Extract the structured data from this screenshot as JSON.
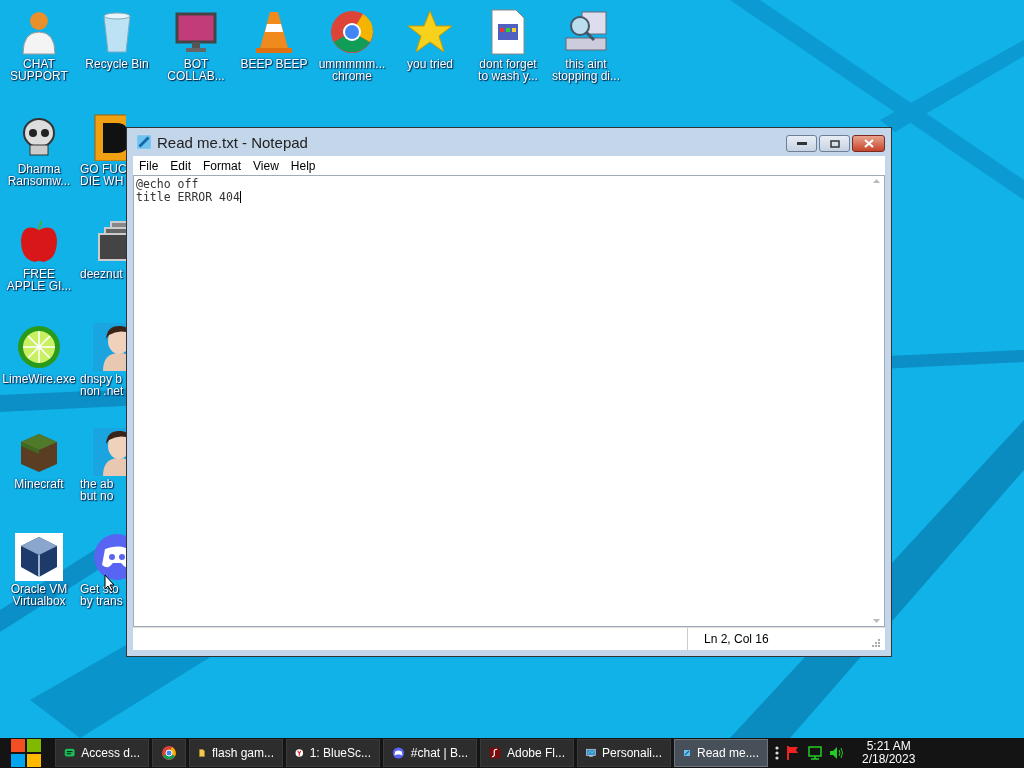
{
  "desktop": {
    "icons": [
      {
        "label": "CHAT\nSUPPORT"
      },
      {
        "label": "Recycle Bin"
      },
      {
        "label": "BOT\nCOLLAB..."
      },
      {
        "label": "BEEP BEEP"
      },
      {
        "label": "ummmmm...\nchrome"
      },
      {
        "label": "you tried"
      },
      {
        "label": "dont forget\nto wash y..."
      },
      {
        "label": "this aint\nstopping di..."
      },
      {
        "label": "Dharma\nRansomw..."
      },
      {
        "label": "GO FUC\nDIE WH"
      },
      {
        "label": "FREE\nAPPLE GI..."
      },
      {
        "label": "deeznut"
      },
      {
        "label": "LimeWire.exe"
      },
      {
        "label": "dnspy b\nnon .net"
      },
      {
        "label": "Minecraft"
      },
      {
        "label": "the ab\nbut no"
      },
      {
        "label": "Oracle VM\nVirtualbox"
      },
      {
        "label": "Get sto\nby trans"
      }
    ]
  },
  "window": {
    "title": "Read me.txt - Notepad",
    "menu": [
      "File",
      "Edit",
      "Format",
      "View",
      "Help"
    ],
    "lines": [
      "@echo off",
      "title ERROR 404"
    ],
    "status_bar": "Ln 2, Col 16"
  },
  "taskbar": {
    "buttons": [
      {
        "kind": "labeled",
        "label": "Access d...",
        "selected": false
      },
      {
        "kind": "icon_only",
        "selected": false
      },
      {
        "kind": "labeled",
        "label": "flash gam...",
        "selected": false
      },
      {
        "kind": "labeled",
        "label": "1: BlueSc...",
        "selected": false
      },
      {
        "kind": "labeled",
        "label": "#chat | B...",
        "selected": false
      },
      {
        "kind": "labeled",
        "label": "Adobe Fl...",
        "selected": false
      },
      {
        "kind": "labeled",
        "label": "Personali...",
        "selected": false
      },
      {
        "kind": "labeled",
        "label": "Read me....",
        "selected": true
      }
    ],
    "clock": {
      "time": "5:21 AM",
      "date": "2/18/2023"
    }
  }
}
